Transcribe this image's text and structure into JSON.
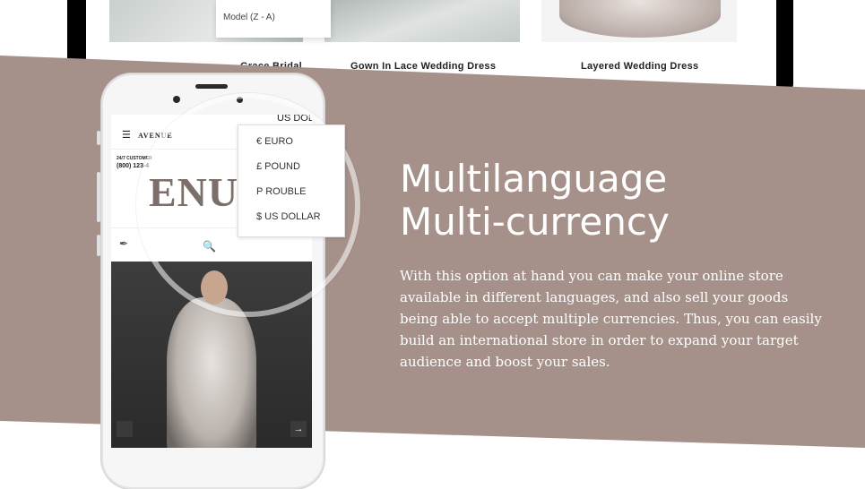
{
  "background_products": {
    "sort_option": "Model (Z - A)",
    "items": [
      "Gown In Lace Wedding Dress",
      "Layered Wedding Dress"
    ],
    "partial_item": "Grace Bridal"
  },
  "phone_screen": {
    "logo": "AVENUE",
    "currency_label": "US DOL",
    "customer_line": "24/7 CUSTOMER",
    "phone_line": "(800) 123-4",
    "big_logo": "ENU"
  },
  "currency_dropdown": {
    "options": [
      "€ EURO",
      "£ POUND",
      "P ROUBLE",
      "$ US DOLLAR"
    ]
  },
  "feature": {
    "title_line1": "Multilanguage",
    "title_line2": "Multi-currency",
    "description": "With this option at hand you can make your online store available in different languages, and also sell your goods being able to accept multiple currencies. Thus, you can easily build an international store in order to expand your target audience and boost your sales."
  },
  "colors": {
    "banner": "#a59189",
    "text": "#ffffff"
  },
  "icons": [
    "hamburger-icon",
    "search-icon",
    "eyedropper-icon",
    "arrow-right-icon"
  ]
}
